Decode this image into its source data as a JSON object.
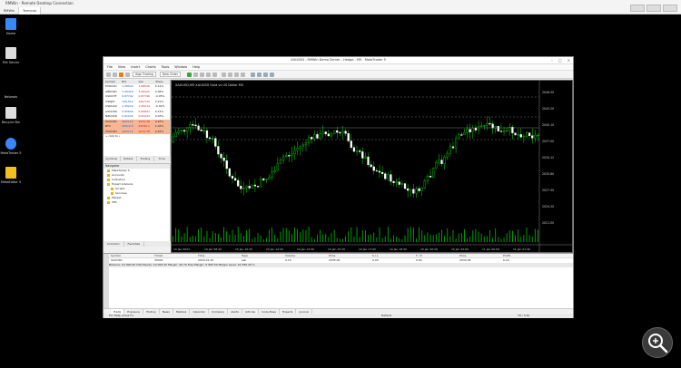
{
  "window": {
    "title": "RMWin - Remote Desktop Connection",
    "tabs": [
      "RMWin",
      "Terminal"
    ],
    "active_tab": 1
  },
  "desktop": {
    "icons": [
      {
        "label": "Home",
        "color": "#3a86ff"
      },
      {
        "label": "File Server",
        "color": "#dddddd"
      },
      {
        "label": "Network",
        "color": "#000000"
      },
      {
        "label": "Recycle Bin",
        "color": "#dddddd"
      },
      {
        "label": "MetaTrader 5",
        "color": "#3a86ff"
      },
      {
        "label": "MetaEditor 5",
        "color": "#f0c020"
      }
    ]
  },
  "terminal": {
    "title": "XAUUSD - RMWin Demo Server - Hedge - M5 - MetaTrader 5",
    "menu": [
      "File",
      "View",
      "Insert",
      "Charts",
      "Tools",
      "Window",
      "Help"
    ],
    "toolbar_algo": "Algo Trading",
    "toolbar_new_order": "New Order",
    "market_watch": {
      "headers": [
        "Symbol",
        "Bid",
        "Ask",
        "!Daily"
      ],
      "rows": [
        {
          "symbol": "EURUSD",
          "bid": "1.08524",
          "ask": "1.08526",
          "change": "0.12%",
          "hl": false
        },
        {
          "symbol": "GBPUSD",
          "bid": "1.26418",
          "ask": "1.26421",
          "change": "0.08%",
          "hl": false
        },
        {
          "symbol": "USDCHF",
          "bid": "0.87742",
          "ask": "0.87746",
          "change": "-0.05%",
          "hl": false
        },
        {
          "symbol": "USDJPY",
          "bid": "149.512",
          "ask": "149.515",
          "change": "0.21%",
          "hl": false
        },
        {
          "symbol": "USDCAD",
          "bid": "1.35210",
          "ask": "1.35214",
          "change": "-0.02%",
          "hl": false
        },
        {
          "symbol": "AUDUSD",
          "bid": "0.65834",
          "ask": "0.65837",
          "change": "0.14%",
          "hl": false
        },
        {
          "symbol": "NZDUSD",
          "bid": "0.61220",
          "ask": "0.61224",
          "change": "0.03%",
          "hl": false
        },
        {
          "symbol": "XAUUSD",
          "bid": "2034.12",
          "ask": "2034.38",
          "change": "0.45%",
          "hl": true
        },
        {
          "symbol": "BTC",
          "bid": "43512.5",
          "ask": "43540.1",
          "change": "1.02%",
          "hl": true
        },
        {
          "symbol": "XAUUSD",
          "bid": "2034.12",
          "ask": "2034.38",
          "change": "0.45%",
          "hl": true
        },
        {
          "symbol": "+ click to add",
          "bid": "",
          "ask": "",
          "change": "",
          "hl": false
        }
      ],
      "tabs": [
        "Symbols",
        "Details",
        "Trading",
        "Ticks"
      ]
    },
    "navigator": {
      "title": "Navigator",
      "items": [
        {
          "label": "MetaTrader 5",
          "level": 1
        },
        {
          "label": "Accounts",
          "level": 1
        },
        {
          "label": "Indicators",
          "level": 1
        },
        {
          "label": "Expert Advisors",
          "level": 1
        },
        {
          "label": "Scripts",
          "level": 2
        },
        {
          "label": "Services",
          "level": 2
        },
        {
          "label": "Market",
          "level": 1
        },
        {
          "label": "VPS",
          "level": 1
        }
      ],
      "tabs": [
        "Common",
        "Favorites"
      ]
    },
    "chart": {
      "symbol_label": "XAUUSD,M5  XAUUSD Gold vs US Dollar  M5",
      "price_labels": [
        "2046.50",
        "2043.20",
        "2040.10",
        "2037.00",
        "2034.12",
        "2030.80",
        "2027.50",
        "2024.20",
        "2021.00"
      ],
      "time_labels": [
        "10 Jan 2024",
        "10 Jan 08:40",
        "10 Jan 10:20",
        "10 Jan 12:00",
        "10 Jan 13:40",
        "10 Jan 15:20",
        "10 Jan 17:00",
        "10 Jan 18:40",
        "10 Jan 20:20",
        "10 Jan 22:00",
        "11 Jan 00:00",
        "11 Jan 01:40"
      ]
    },
    "toolbox": {
      "columns": [
        "Symbol",
        "Ticket",
        "Time",
        "Type",
        "Volume",
        "Price",
        "S / L",
        "T / P",
        "Price",
        "Profit"
      ],
      "row": [
        "XAUUSD",
        "30001",
        "2024.01.10",
        "sell",
        "0.10",
        "2035.00",
        "0.00",
        "0.00",
        "2034.38",
        "6.20"
      ],
      "balance_text": "Balance: 10 000.00 USD  Equity: 10 006.20  Margin: 40.70  Free Margin: 9 965.50  Margin Level: 24 585.26 %",
      "tabs": [
        "Trade",
        "Exposure",
        "History",
        "News",
        "Mailbox",
        "Calendar",
        "Company",
        "Alerts",
        "Articles",
        "Code Base",
        "Experts",
        "Journal"
      ],
      "active_tab": 0,
      "status_left": "For Help, press F1",
      "status_mid": "Default",
      "status_right": "34 / 0 kb"
    }
  }
}
